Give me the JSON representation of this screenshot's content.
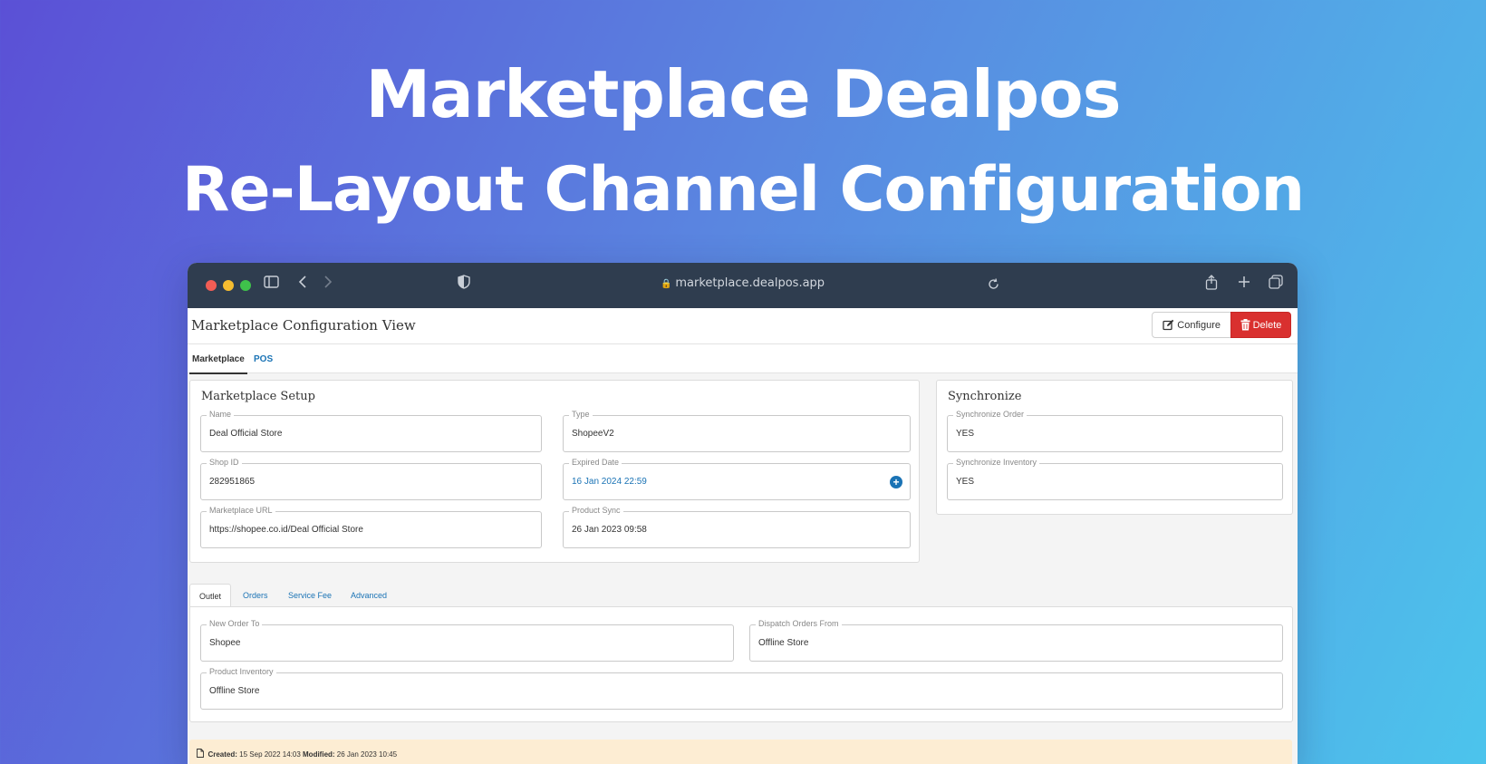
{
  "hero": {
    "line1": "Marketplace Dealpos",
    "line2": "Re-Layout Channel Configuration"
  },
  "browser": {
    "url": "marketplace.dealpos.app",
    "icons": [
      "sidebar-icon",
      "back-icon",
      "forward-icon",
      "shield-icon",
      "lock-icon",
      "reload-icon",
      "share-icon",
      "new-tab-icon",
      "tabs-icon"
    ]
  },
  "header": {
    "title": "Marketplace Configuration View",
    "configure_label": "Configure",
    "delete_label": "Delete"
  },
  "top_tabs": {
    "marketplace": "Marketplace",
    "pos": "POS"
  },
  "setup": {
    "title": "Marketplace Setup",
    "name_label": "Name",
    "name_value": "Deal Official Store",
    "type_label": "Type",
    "type_value": "ShopeeV2",
    "shop_id_label": "Shop ID",
    "shop_id_value": "282951865",
    "expired_label": "Expired Date",
    "expired_value": "16 Jan 2024 22:59",
    "url_label": "Marketplace URL",
    "url_value": "https://shopee.co.id/Deal Official Store",
    "sync_label": "Product Sync",
    "sync_value": "26 Jan 2023 09:58"
  },
  "synchronize": {
    "title": "Synchronize",
    "order_label": "Synchronize Order",
    "order_value": "YES",
    "inventory_label": "Synchronize Inventory",
    "inventory_value": "YES"
  },
  "sub_tabs": {
    "outlet": "Outlet",
    "orders": "Orders",
    "service_fee": "Service Fee",
    "advanced": "Advanced"
  },
  "outlet": {
    "new_order_label": "New Order To",
    "new_order_value": "Shopee",
    "dispatch_label": "Dispatch Orders From",
    "dispatch_value": "Offline Store",
    "inventory_label": "Product Inventory",
    "inventory_value": "Offline Store"
  },
  "footer": {
    "created_label": "Created:",
    "created_value": "15 Sep 2022 14:03",
    "modified_label": "Modified:",
    "modified_value": "26 Jan 2023 10:45"
  },
  "colors": {
    "accent": "#1a73b5",
    "danger": "#d9302f",
    "chrome": "#2f3d4f"
  }
}
